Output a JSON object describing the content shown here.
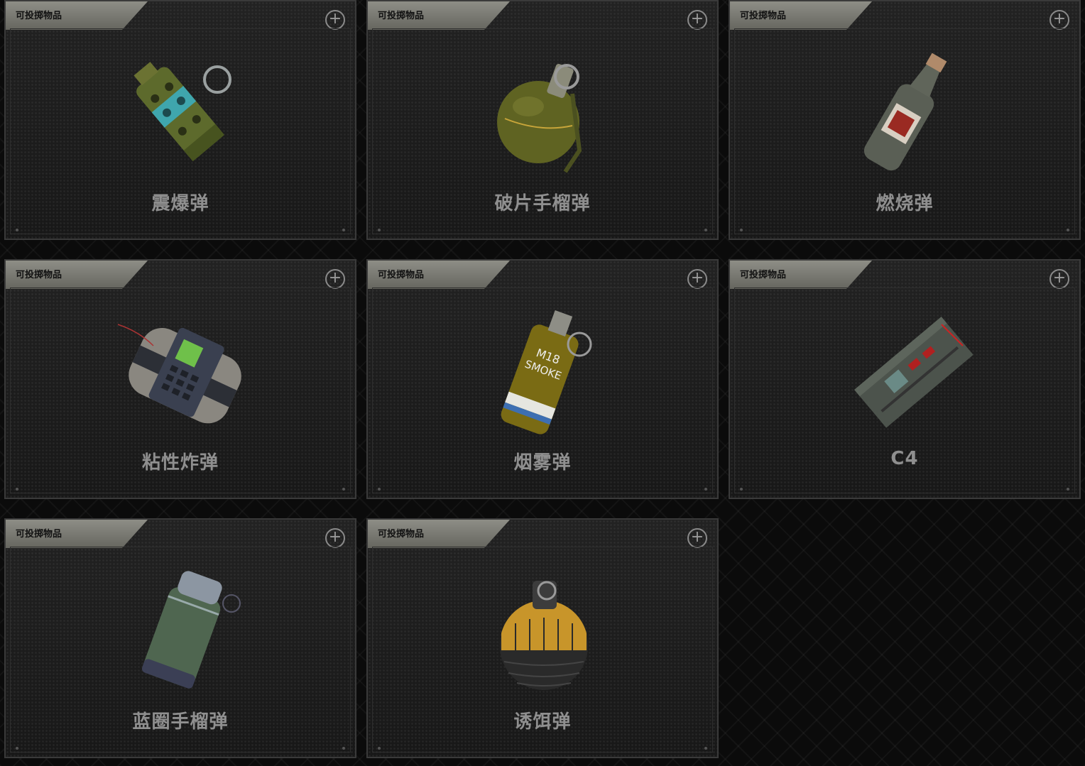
{
  "grid": {
    "cards": [
      {
        "category": "可投掷物品",
        "name": "震爆弹",
        "icon": "flashbang-icon"
      },
      {
        "category": "可投掷物品",
        "name": "破片手榴弹",
        "icon": "frag-grenade-icon"
      },
      {
        "category": "可投掷物品",
        "name": "燃烧弹",
        "icon": "molotov-icon"
      },
      {
        "category": "可投掷物品",
        "name": "粘性炸弹",
        "icon": "sticky-bomb-icon"
      },
      {
        "category": "可投掷物品",
        "name": "烟雾弹",
        "icon": "smoke-grenade-icon"
      },
      {
        "category": "可投掷物品",
        "name": "C4",
        "icon": "c4-icon"
      },
      {
        "category": "可投掷物品",
        "name": "蓝圈手榴弹",
        "icon": "bluezone-grenade-icon"
      },
      {
        "category": "可投掷物品",
        "name": "诱饵弹",
        "icon": "decoy-grenade-icon"
      }
    ],
    "add_symbol": "+"
  },
  "art_text": {
    "smoke_label": "M18",
    "smoke_label2": "SMOKE"
  }
}
